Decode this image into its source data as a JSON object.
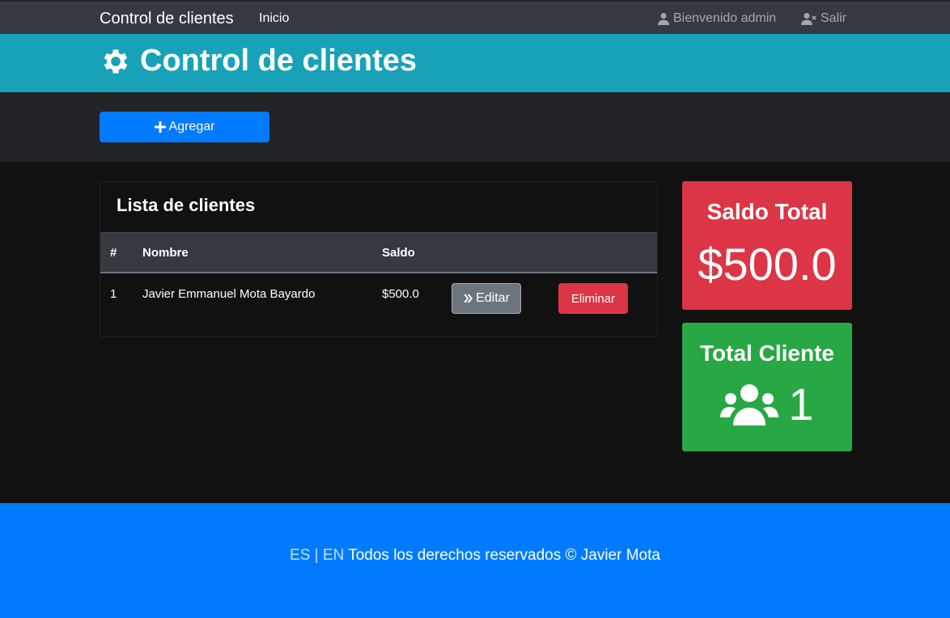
{
  "navbar": {
    "brand": "Control de clientes",
    "inicio": "Inicio",
    "welcome": "Bienvenido admin",
    "logout": "Salir"
  },
  "header": {
    "title": "Control de clientes",
    "icon": "gear-icon"
  },
  "actions": {
    "add_label": "Agregar"
  },
  "clients_card": {
    "title": "Lista de clientes",
    "columns": [
      "#",
      "Nombre",
      "Saldo"
    ],
    "rows": [
      {
        "num": "1",
        "name": "Javier Emmanuel Mota Bayardo",
        "saldo": "$500.0",
        "edit_label": "Editar",
        "delete_label": "Eliminar"
      }
    ]
  },
  "stats": {
    "saldo_label": "Saldo Total",
    "saldo_value": "$500.0",
    "total_label": "Total Cliente",
    "total_value": "1"
  },
  "footer": {
    "lang_es": "ES",
    "separator": "|",
    "lang_en": "EN",
    "rights": "Todos los derechos reservados © Javier Mota"
  },
  "colors": {
    "navbar": "#343a40",
    "header": "#17a2b8",
    "primary": "#007bff",
    "danger": "#dc3545",
    "success": "#28a745",
    "secondary": "#6c757d"
  }
}
